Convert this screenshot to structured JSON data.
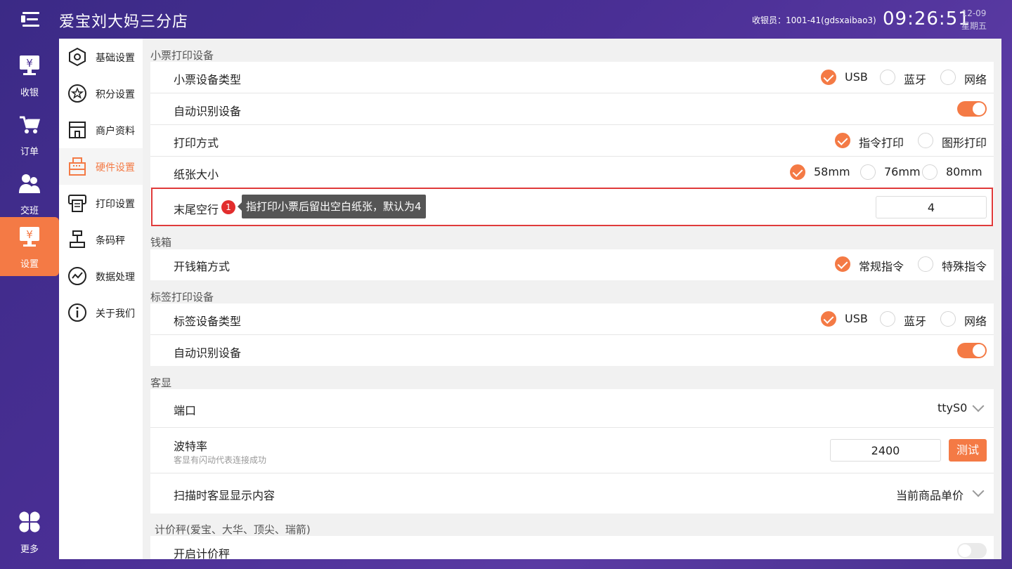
{
  "header": {
    "store_name": "爱宝刘大妈三分店",
    "cashier": "收银员：1001-41(gdsxaibao3)",
    "time": "09:26:51",
    "date": "12-09",
    "weekday": "星期五"
  },
  "leftnav": {
    "items": [
      {
        "label": "收银",
        "icon": "cash-register-icon"
      },
      {
        "label": "订单",
        "icon": "order-cart-icon"
      },
      {
        "label": "交班",
        "icon": "shift-handover-icon"
      },
      {
        "label": "设置",
        "icon": "settings-monitor-icon",
        "active": true
      },
      {
        "label": "更多",
        "icon": "more-grid-icon"
      }
    ]
  },
  "submenu": {
    "items": [
      {
        "label": "基础设置",
        "icon": "hexagon-icon"
      },
      {
        "label": "积分设置",
        "icon": "star-circle-icon"
      },
      {
        "label": "商户资料",
        "icon": "store-icon"
      },
      {
        "label": "硬件设置",
        "icon": "cash-register-icon",
        "active": true
      },
      {
        "label": "打印设置",
        "icon": "printer-receipt-icon"
      },
      {
        "label": "条码秤",
        "icon": "scale-icon"
      },
      {
        "label": "数据处理",
        "icon": "chart-circle-icon"
      },
      {
        "label": "关于我们",
        "icon": "info-icon"
      }
    ]
  },
  "receipt_printer": {
    "section_title": "小票打印设备",
    "device_type": {
      "label": "小票设备类型",
      "options": [
        "USB",
        "蓝牙",
        "网络"
      ],
      "selected": "USB"
    },
    "auto_detect": {
      "label": "自动识别设备",
      "on": true
    },
    "print_mode": {
      "label": "打印方式",
      "options": [
        "指令打印",
        "图形打印"
      ],
      "selected": "指令打印"
    },
    "paper_size": {
      "label": "纸张大小",
      "options": [
        "58mm",
        "76mm",
        "80mm"
      ],
      "selected": "58mm"
    },
    "trailing_lines": {
      "label": "末尾空行",
      "badge": "1",
      "tooltip": "指打印小票后留出空白纸张，默认为4",
      "value": "4"
    }
  },
  "cash_drawer": {
    "section_title": "钱箱",
    "open_mode": {
      "label": "开钱箱方式",
      "options": [
        "常规指令",
        "特殊指令"
      ],
      "selected": "常规指令"
    }
  },
  "label_printer": {
    "section_title": "标签打印设备",
    "device_type": {
      "label": "标签设备类型",
      "options": [
        "USB",
        "蓝牙",
        "网络"
      ],
      "selected": "USB"
    },
    "auto_detect": {
      "label": "自动识别设备",
      "on": true
    }
  },
  "customer_display": {
    "section_title": "客显",
    "port": {
      "label": "端口",
      "value": "ttyS0"
    },
    "baud": {
      "label": "波特率",
      "hint": "客显有闪动代表连接成功",
      "value": "2400",
      "test_label": "测试"
    },
    "scan_content": {
      "label": "扫描时客显显示内容",
      "value": "当前商品单价"
    }
  },
  "price_scale": {
    "section_title": "计价秤(爱宝、大华、顶尖、瑞箭)",
    "enable": {
      "label": "开启计价秤",
      "on": false
    }
  },
  "colors": {
    "accent": "#f47a45",
    "highlight": "#e03a3a",
    "bg": "#4a2f95"
  }
}
